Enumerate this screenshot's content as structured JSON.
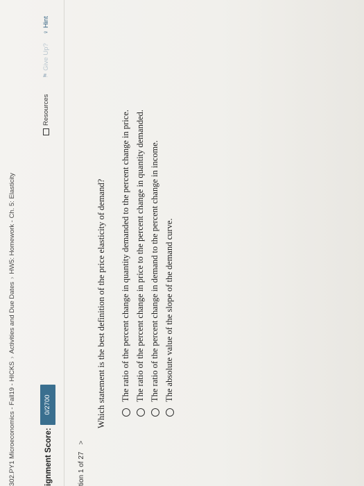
{
  "breadcrumb": {
    "course": "302.PY1 Microeconomics - Fall19 - HICKS",
    "section": "Activities and Due Dates",
    "assignment": "HW5: Homework - Ch. 5: Elasticity"
  },
  "score": {
    "label": "ignment Score:",
    "value": "0/2700"
  },
  "toolbar": {
    "resources": "Resources",
    "give_up": "Give Up?",
    "hint": "Hint"
  },
  "question_nav": {
    "label": "tion 1 of 27",
    "next": ">"
  },
  "question": {
    "prompt": "Which statement is the best definition of the price elasticity of demand?",
    "options": [
      "The ratio of the percent change in quantity demanded to the percent change in price.",
      "The ratio of the percent change in price to the percent change in quantity demanded.",
      "The ratio of the percent change in demand to the percent change in income.",
      "The absolute value of the slope of the demand curve."
    ]
  }
}
